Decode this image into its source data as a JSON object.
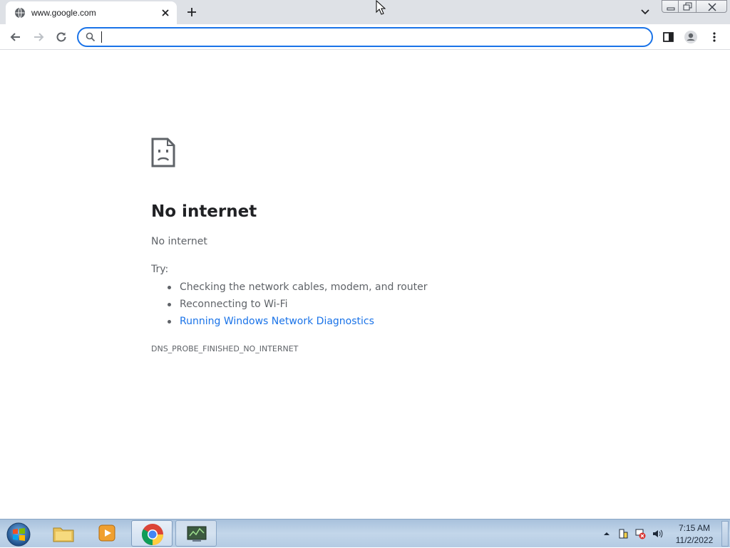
{
  "browser": {
    "tab": {
      "title": "www.google.com",
      "favicon": "globe-icon"
    },
    "toolbar": {
      "back": "arrow-left-icon",
      "forward": "arrow-right-icon",
      "reload": "reload-icon",
      "omnibox": {
        "value": "",
        "icon": "search-icon"
      },
      "side_panel": "side-panel-icon",
      "profile": "person-icon",
      "menu": "kebab-menu-icon"
    }
  },
  "error_page": {
    "icon": "sad-page-icon",
    "title": "No internet",
    "subtitle": "No internet",
    "try_label": "Try:",
    "suggestions": [
      "Checking the network cables, modem, and router",
      "Reconnecting to Wi-Fi",
      "Running Windows Network Diagnostics"
    ],
    "error_code": "DNS_PROBE_FINISHED_NO_INTERNET"
  },
  "taskbar": {
    "apps": [
      "file-explorer-icon",
      "media-player-icon",
      "chrome-icon",
      "network-tool-icon"
    ],
    "clock": {
      "time": "7:15 AM",
      "date": "11/2/2022"
    }
  },
  "colors": {
    "accent": "#1a73e8",
    "tabstrip": "#dee1e6",
    "text": "#202124",
    "muted": "#5f6368"
  }
}
